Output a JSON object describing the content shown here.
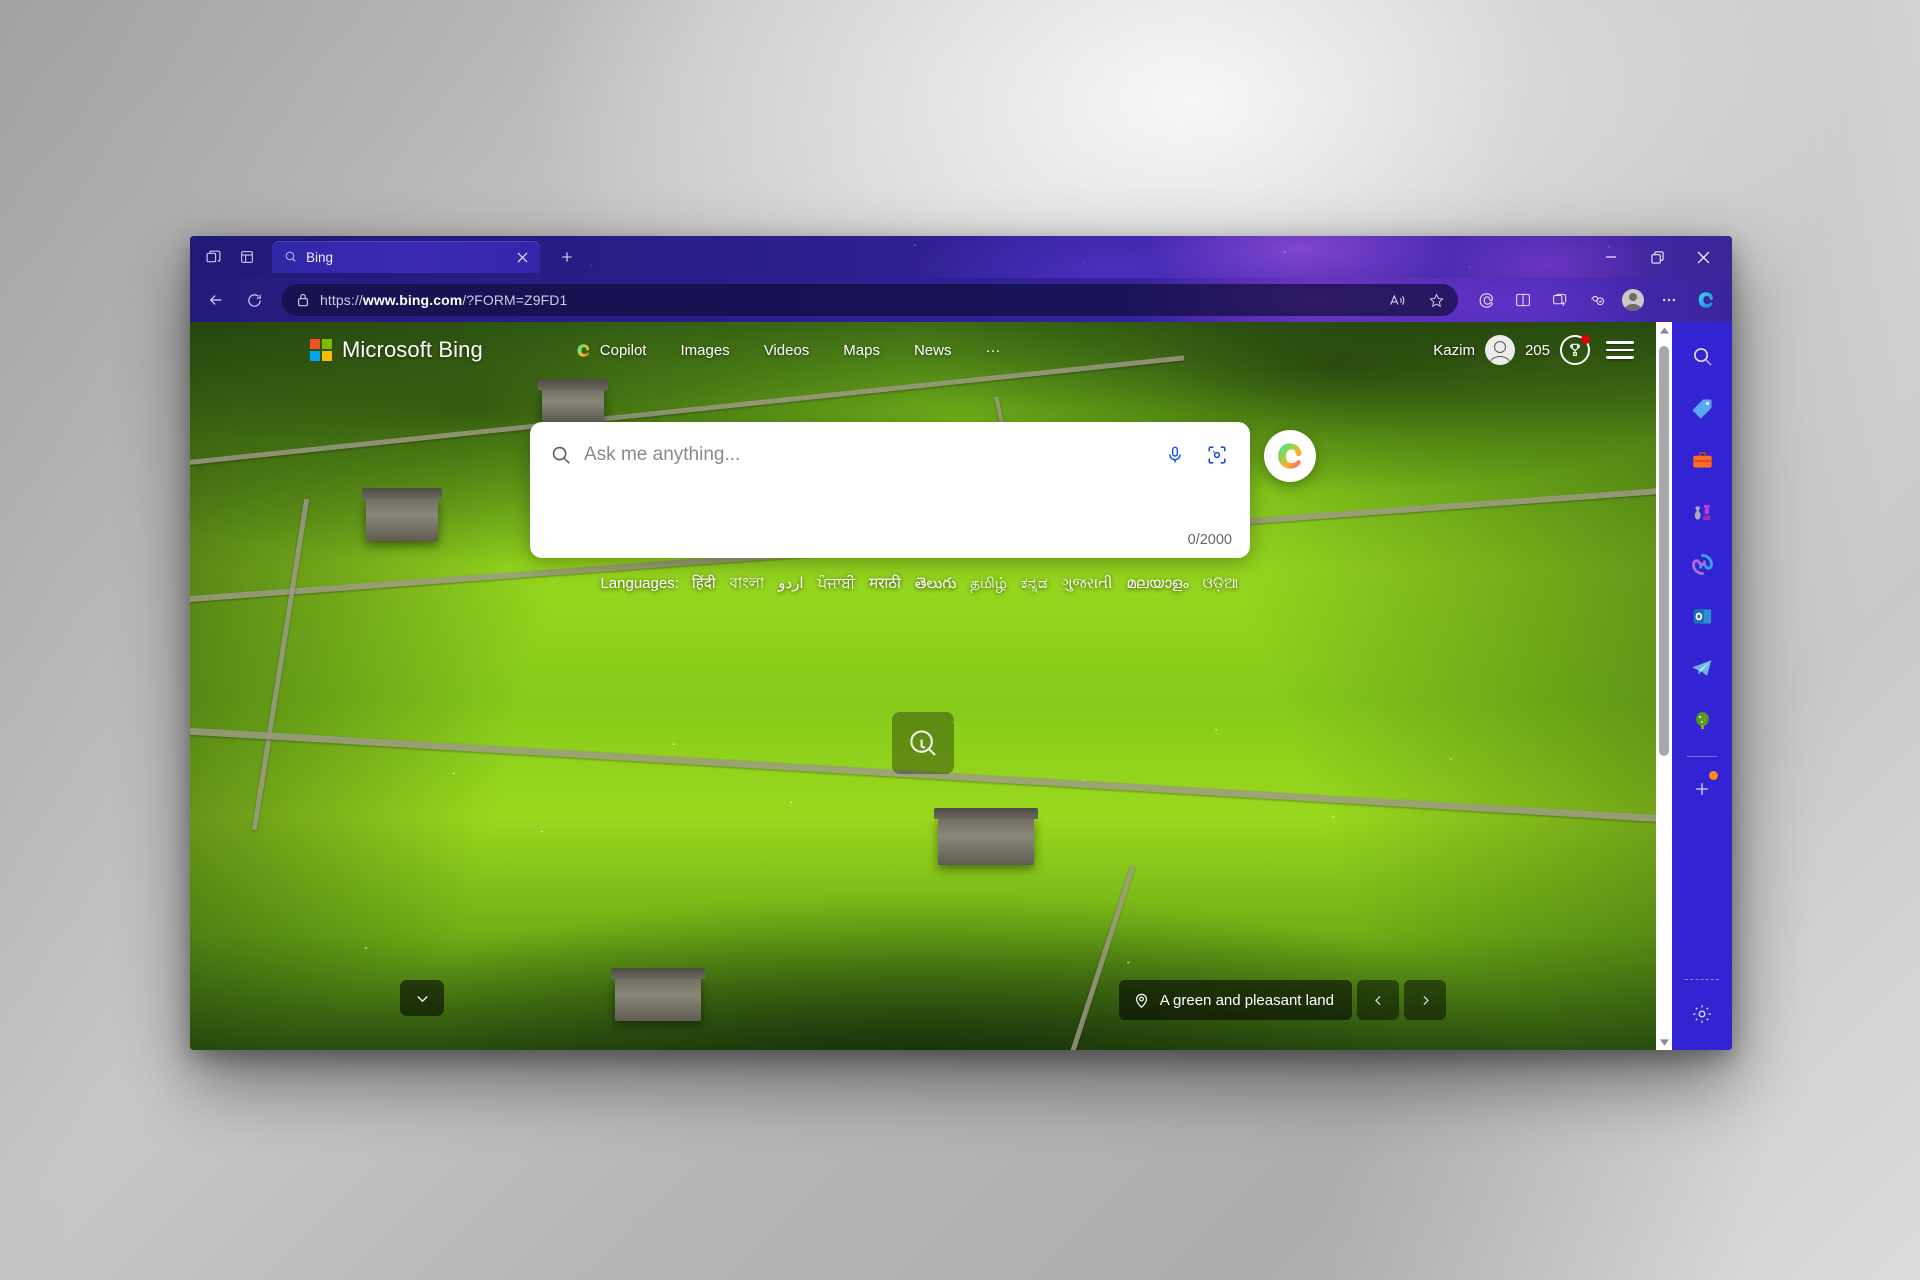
{
  "browser": {
    "tab_strip": {
      "tab_search_tooltip": "Tab actions menu",
      "split_screen_tooltip": "Split screen",
      "new_tab_tooltip": "New tab"
    },
    "tabs": [
      {
        "title": "Bing",
        "favicon": "search-icon",
        "active": true,
        "close_label": "×"
      }
    ],
    "window_controls": {
      "minimize": "–",
      "restore": "❐",
      "close": "✕"
    },
    "toolbar": {
      "back": "back-arrow-icon",
      "refresh": "refresh-icon",
      "lock": "lock-icon",
      "url_prefix": "https://",
      "url_host": "www.bing.com",
      "url_suffix": "/?FORM=Z9FD1",
      "url_full": "https://www.bing.com/?FORM=Z9FD1",
      "read_aloud": "read-aloud-icon",
      "favorite": "star-icon",
      "copilot_mode": "copilot-mode-icon",
      "split_screen": "split-screen-icon",
      "collections": "collections-icon",
      "browser_essentials": "browser-essentials-icon",
      "profile": "Kazim",
      "settings_more": "···",
      "copilot": "copilot-icon"
    },
    "sidebar": {
      "items": [
        {
          "name": "search",
          "label": "Search"
        },
        {
          "name": "shopping",
          "label": "Shopping"
        },
        {
          "name": "tools",
          "label": "Tools"
        },
        {
          "name": "games",
          "label": "Games"
        },
        {
          "name": "microsoft365",
          "label": "Microsoft 365"
        },
        {
          "name": "outlook",
          "label": "Outlook"
        },
        {
          "name": "telegram",
          "label": "Telegram"
        },
        {
          "name": "tree",
          "label": "Drop"
        }
      ],
      "customize": {
        "label": "Customize",
        "badge": true
      },
      "settings": {
        "label": "Sidebar settings"
      }
    },
    "scrollbar": {
      "up": "▲",
      "down": "▼"
    }
  },
  "page": {
    "header": {
      "logo_text": "Microsoft Bing",
      "logo_colors": [
        "#f25022",
        "#7fba00",
        "#00a4ef",
        "#ffb900"
      ],
      "nav": [
        {
          "label": "Copilot",
          "icon": "copilot-icon"
        },
        {
          "label": "Images",
          "icon": ""
        },
        {
          "label": "Videos",
          "icon": ""
        },
        {
          "label": "Maps",
          "icon": ""
        },
        {
          "label": "News",
          "icon": ""
        },
        {
          "label": "···",
          "icon": ""
        }
      ],
      "user_name": "Kazim",
      "rewards_points": "205",
      "rewards_icon": "trophy-icon",
      "rewards_notification": true,
      "menu_icon": "hamburger-icon"
    },
    "search": {
      "placeholder": "Ask me anything...",
      "value": "",
      "counter": "0/2000",
      "search_icon": "search-icon",
      "mic_icon": "microphone-icon",
      "visual_search_icon": "visual-search-icon",
      "copilot_button": "copilot-icon",
      "accent_color": "#174ae6"
    },
    "languages": {
      "label": "Languages:",
      "items": [
        "हिंदी",
        "বাংলা",
        "اردو",
        "ਪੰਜਾਬੀ",
        "मराठी",
        "తెలుగు",
        "தமிழ்",
        "ಕನ್ನಡ",
        "ગુજરાતી",
        "മലയാളം",
        "ଓଡ଼ିଆ"
      ]
    },
    "image_overlay": {
      "visual_search": "visual-search-icon"
    },
    "footer": {
      "expand_button": "chevron-down-icon",
      "caption": "A green and pleasant land",
      "location_icon": "location-pin-icon",
      "prev": "‹",
      "next": "›"
    }
  }
}
